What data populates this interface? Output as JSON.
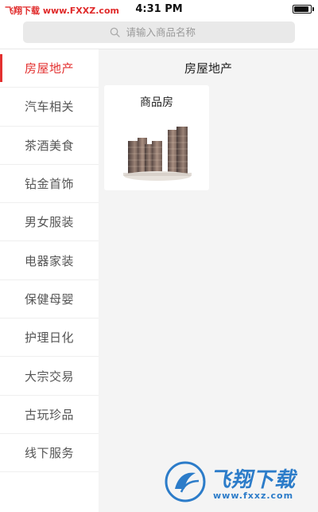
{
  "status_bar": {
    "watermark": "飞翔下载 www.FXXZ.com",
    "time": "4:31 PM"
  },
  "search": {
    "placeholder": "请输入商品名称"
  },
  "sidebar": {
    "items": [
      {
        "label": "房屋地产",
        "active": true
      },
      {
        "label": "汽车相关"
      },
      {
        "label": "茶酒美食"
      },
      {
        "label": "钻金首饰"
      },
      {
        "label": "男女服装"
      },
      {
        "label": "电器家装"
      },
      {
        "label": "保健母婴"
      },
      {
        "label": "护理日化"
      },
      {
        "label": "大宗交易"
      },
      {
        "label": "古玩珍品"
      },
      {
        "label": "线下服务"
      }
    ]
  },
  "content": {
    "title": "房屋地产",
    "products": [
      {
        "name": "商品房",
        "image_icon": "buildings-icon"
      }
    ]
  },
  "watermark_bottom": {
    "brand": "飞翔下载",
    "url": "www.fxxz.com"
  },
  "colors": {
    "accent": "#e3302f",
    "watermark_blue": "#2c7cc9"
  }
}
